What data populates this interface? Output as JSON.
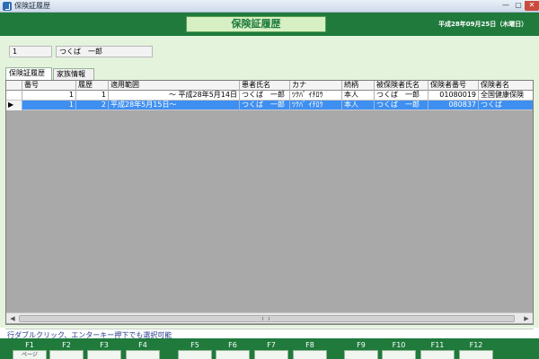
{
  "window": {
    "title": "保険証履歴",
    "min": "—",
    "max": "▢",
    "close": "✕"
  },
  "header": {
    "screen_title": "保険証履歴",
    "date": "平成28年09月25日（木曜日）"
  },
  "patient": {
    "number": "1",
    "name": "つくば　一郎"
  },
  "tabs": [
    {
      "label": "保険証履歴",
      "active": true
    },
    {
      "label": "家族情報",
      "active": false
    }
  ],
  "grid": {
    "columns": [
      "番号",
      "履歴",
      "適用範囲",
      "患者氏名",
      "カナ",
      "続柄",
      "被保険者氏名",
      "保険者番号",
      "保険者名"
    ],
    "rows": [
      {
        "indicator": "",
        "cells": [
          "1",
          "1",
          "〜 平成28年5月14日",
          "つくば　一郎",
          "ﾂｸﾊﾞ ｲﾁﾛｳ",
          "本人",
          "つくば　一郎",
          "01080019",
          "全国健康保険"
        ]
      },
      {
        "indicator": "▶",
        "cells": [
          "1",
          "2",
          "平成28年5月15日〜",
          "つくば　一郎",
          "ﾂｸﾊﾞ ｲﾁﾛｳ",
          "本人",
          "つくば　一郎",
          "080837",
          "つくば"
        ]
      }
    ]
  },
  "scroll": {
    "left": "◀",
    "right": "▶"
  },
  "hint": "行ダブルクリック、エンターキー押下でも選択可能",
  "fkeys": [
    {
      "label": "F1",
      "button": "ページ"
    },
    {
      "label": "F2",
      "button": ""
    },
    {
      "label": "F3",
      "button": ""
    },
    {
      "label": "F4",
      "button": ""
    },
    {
      "label": "F5",
      "button": ""
    },
    {
      "label": "F6",
      "button": ""
    },
    {
      "label": "F7",
      "button": ""
    },
    {
      "label": "F8",
      "button": ""
    },
    {
      "label": "F9",
      "button": ""
    },
    {
      "label": "F10",
      "button": ""
    },
    {
      "label": "F11",
      "button": ""
    },
    {
      "label": "F12",
      "button": ""
    }
  ],
  "colors": {
    "header_green": "#1f7a3c",
    "panel_green": "#e3f3dc",
    "selection_blue": "#3f8ff0",
    "hint_blue": "#23398a"
  }
}
